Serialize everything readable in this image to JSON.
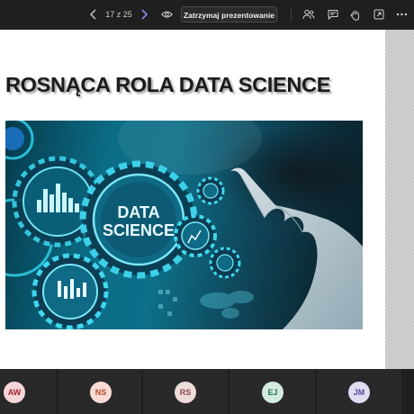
{
  "toolbar": {
    "slide_counter": "17 z 25",
    "stop_presenting_label": "Zatrzymaj prezentowanie",
    "icons": [
      "chevron-left-icon",
      "chevron-right-icon",
      "eye-icon",
      "people-icon",
      "chat-icon",
      "raise-hand-icon",
      "share-icon",
      "more-icon"
    ]
  },
  "slide": {
    "title": "ROSNĄCA ROLA DATA SCIENCE",
    "image": {
      "label_line1": "DATA",
      "label_line2": "SCIENCE"
    }
  },
  "participants": [
    {
      "initials": "AW",
      "bg": "#f5d6d9",
      "fg": "#a4262c"
    },
    {
      "initials": "NS",
      "bg": "#fbdcd4",
      "fg": "#b54a2e"
    },
    {
      "initials": "RS",
      "bg": "#eddcd9",
      "fg": "#8c4a45"
    },
    {
      "initials": "EJ",
      "bg": "#d3ecdf",
      "fg": "#22744a"
    },
    {
      "initials": "JM",
      "bg": "#e1dcf2",
      "fg": "#5b4a9a"
    }
  ]
}
